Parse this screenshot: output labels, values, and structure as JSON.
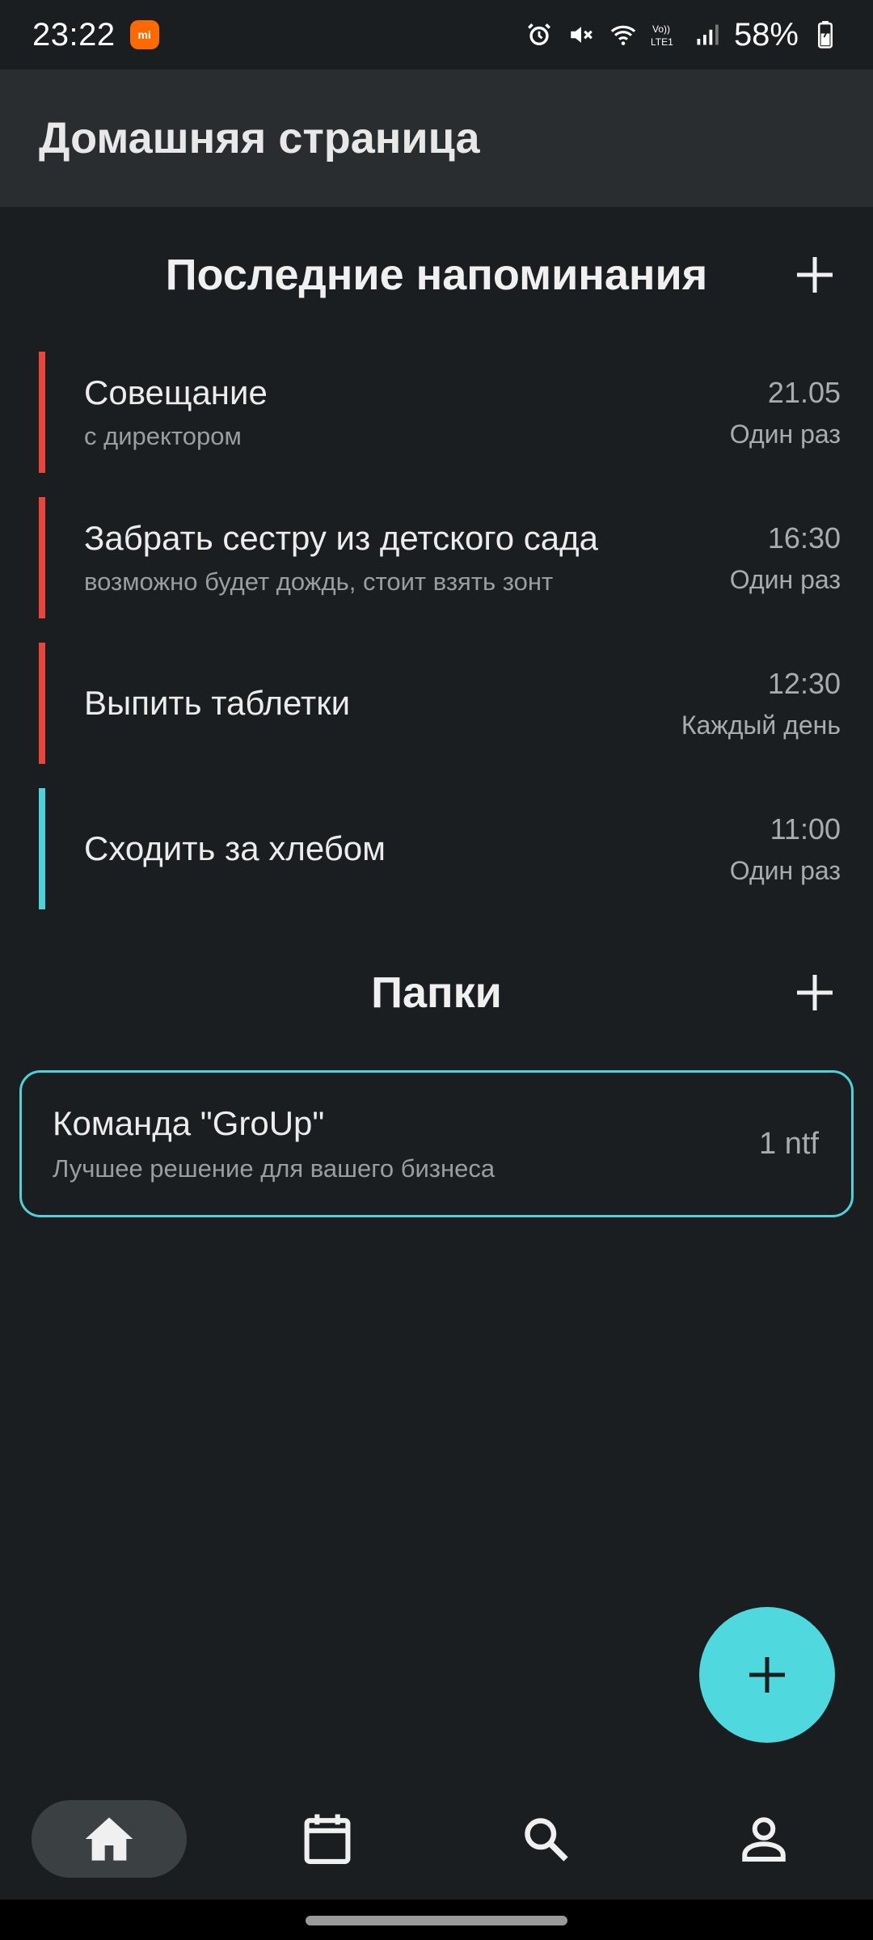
{
  "status_bar": {
    "time": "23:22",
    "battery": "58%",
    "icons": [
      "xiaomi-badge-icon",
      "alarm-icon",
      "mute-icon",
      "wifi-icon",
      "volte-icon",
      "signal-icon",
      "battery-icon"
    ]
  },
  "app_bar": {
    "title": "Домашняя страница"
  },
  "reminders_section": {
    "title": "Последние напоминания",
    "add_icon": "plus-icon",
    "items": [
      {
        "title": "Совещание",
        "subtitle": "с директором",
        "time": "21.05",
        "repeat": "Один раз",
        "accent": "#e8463c"
      },
      {
        "title": "Забрать сестру из детского сада",
        "subtitle": "возможно будет дождь, стоит взять зонт",
        "time": "16:30",
        "repeat": "Один раз",
        "accent": "#e8463c"
      },
      {
        "title": "Выпить таблетки",
        "subtitle": "",
        "time": "12:30",
        "repeat": "Каждый день",
        "accent": "#e8463c"
      },
      {
        "title": "Сходить за хлебом",
        "subtitle": "",
        "time": "11:00",
        "repeat": "Один раз",
        "accent": "#4fd1d9"
      }
    ]
  },
  "folders_section": {
    "title": "Папки",
    "add_icon": "plus-icon",
    "items": [
      {
        "title": "Команда \"GroUp\"",
        "subtitle": "Лучшее решение для вашего бизнеса",
        "count": "1 ntf",
        "border": "#4fd1d9"
      }
    ]
  },
  "fab": {
    "icon": "plus-icon",
    "color": "#4fd9de"
  },
  "bottom_nav": {
    "items": [
      {
        "icon": "home-icon",
        "active": true
      },
      {
        "icon": "calendar-icon",
        "active": false
      },
      {
        "icon": "search-icon",
        "active": false
      },
      {
        "icon": "profile-icon",
        "active": false
      }
    ]
  },
  "colors": {
    "background": "#1b1e20",
    "app_bar": "#2a2d2f",
    "accent_red": "#e8463c",
    "accent_cyan": "#4fd1d9"
  }
}
